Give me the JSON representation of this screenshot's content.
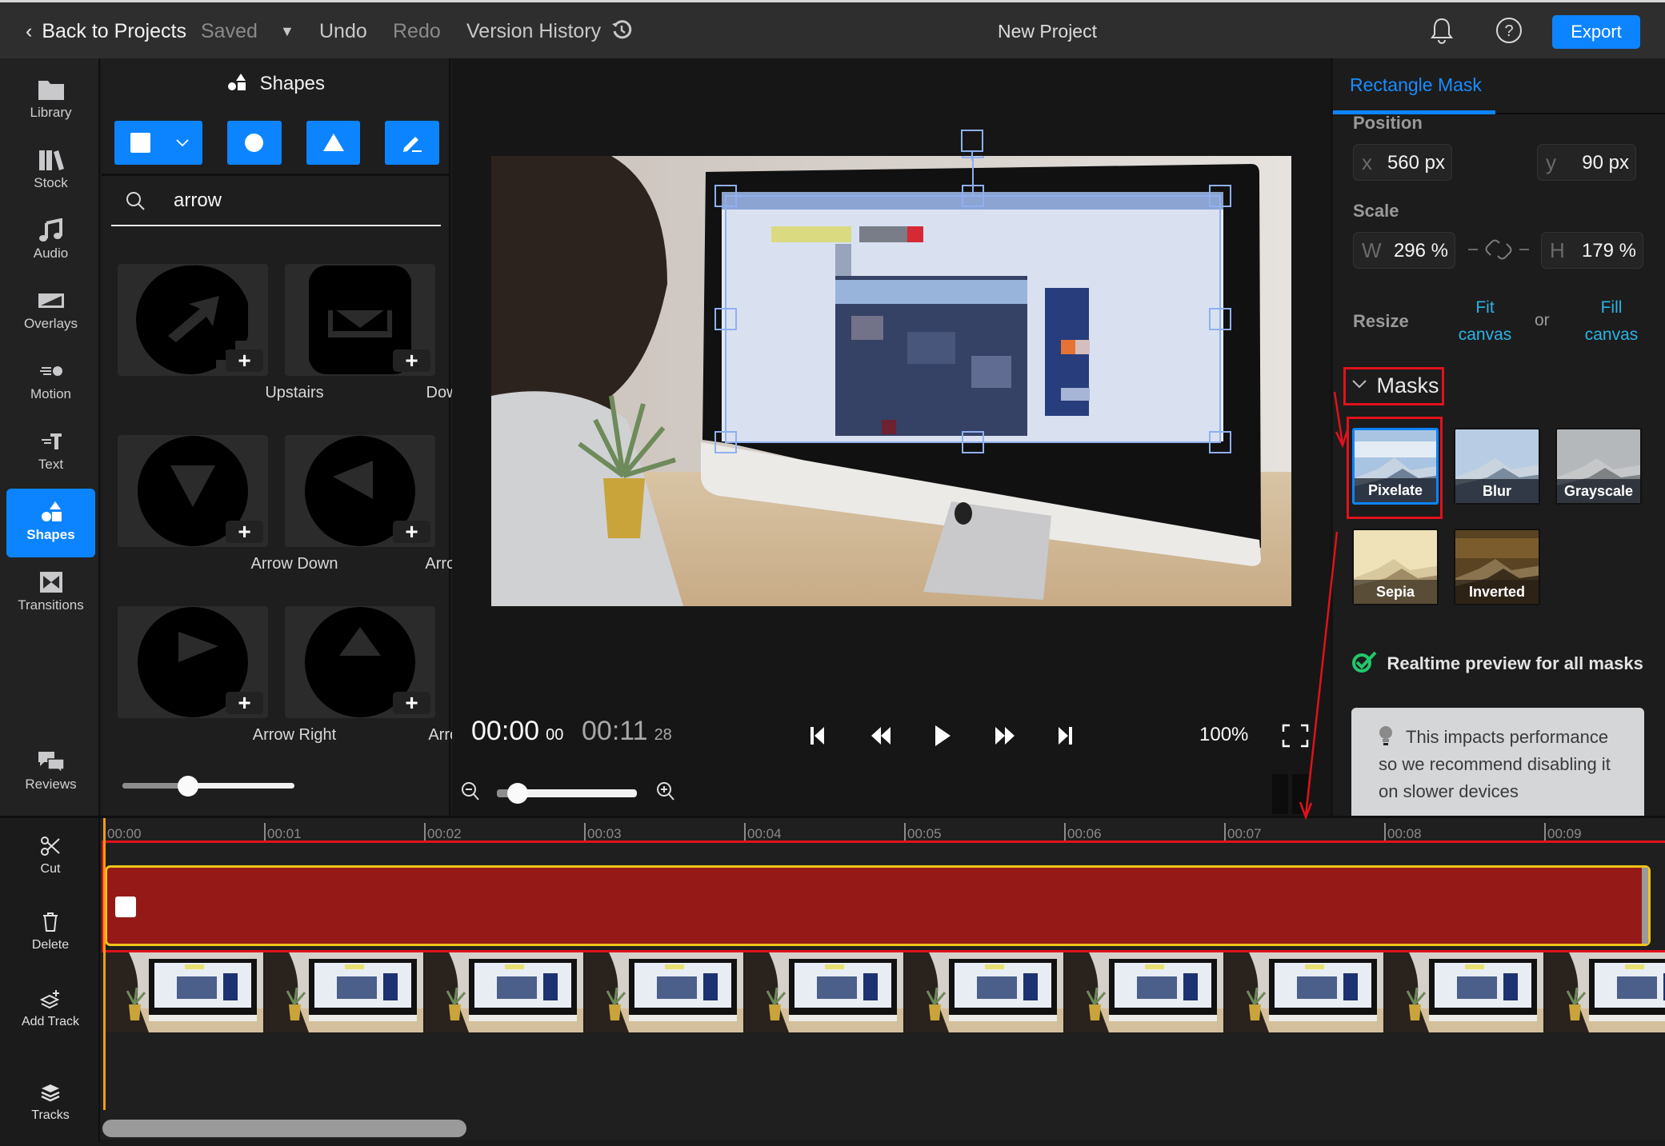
{
  "topbar": {
    "back_label": "Back to Projects",
    "saved_label": "Saved",
    "undo_label": "Undo",
    "redo_label": "Redo",
    "version_history_label": "Version History",
    "project_title": "New Project",
    "export_label": "Export"
  },
  "left_nav": {
    "items": [
      {
        "label": "Library",
        "icon": "folder-icon"
      },
      {
        "label": "Stock",
        "icon": "stock-books-icon"
      },
      {
        "label": "Audio",
        "icon": "music-note-icon"
      },
      {
        "label": "Overlays",
        "icon": "overlay-icon"
      },
      {
        "label": "Motion",
        "icon": "motion-icon"
      },
      {
        "label": "Text",
        "icon": "text-icon"
      },
      {
        "label": "Shapes",
        "icon": "shapes-icon",
        "active": true
      },
      {
        "label": "Transitions",
        "icon": "transition-icon"
      },
      {
        "label": "Reviews",
        "icon": "chat-bubbles-icon"
      }
    ]
  },
  "shapes_panel": {
    "title": "Shapes",
    "tool_buttons": [
      "rectangle",
      "circle",
      "triangle",
      "pen"
    ],
    "search": {
      "value": "arrow",
      "placeholder": "Search"
    },
    "items": [
      {
        "label": "Upstairs"
      },
      {
        "label": "Download"
      },
      {
        "label": "Arrow Down"
      },
      {
        "label": "Arrow Left"
      },
      {
        "label": "Arrow Right"
      },
      {
        "label": "Arrow Up"
      }
    ],
    "size_slider_value": 0.38
  },
  "player": {
    "current_time": "00:00",
    "current_frames": "00",
    "duration": "00:11",
    "duration_frames": "28",
    "zoom": "100%",
    "timeline_zoom_slider_value": 0.15
  },
  "right_panel": {
    "tab": "Rectangle Mask",
    "position_label": "Position",
    "x_prefix": "x",
    "x_value": "560 px",
    "y_prefix": "y",
    "y_value": "90 px",
    "scale_label": "Scale",
    "w_prefix": "W",
    "w_value": "296 %",
    "h_prefix": "H",
    "h_value": "179 %",
    "resize_label": "Resize",
    "fit_canvas_line1": "Fit",
    "fit_canvas_line2": "canvas",
    "or_label": "or",
    "fill_canvas_line1": "Fill",
    "fill_canvas_line2": "canvas",
    "masks_label": "Masks",
    "masks": [
      {
        "label": "Pixelate",
        "selected": true
      },
      {
        "label": "Blur"
      },
      {
        "label": "Grayscale"
      },
      {
        "label": "Sepia"
      },
      {
        "label": "Inverted"
      }
    ],
    "realtime_label": "Realtime preview for all masks",
    "tip_text": "This impacts performance so we recommend disabling it on slower devices"
  },
  "timeline": {
    "tools": [
      {
        "label": "Cut",
        "icon": "scissors-icon"
      },
      {
        "label": "Delete",
        "icon": "trash-icon"
      },
      {
        "label": "Add Track",
        "icon": "add-layer-icon"
      },
      {
        "label": "Tracks",
        "icon": "layers-icon"
      }
    ],
    "ticks": [
      "00:00",
      "00:01",
      "00:02",
      "00:03",
      "00:04",
      "00:05",
      "00:06",
      "00:07",
      "00:08",
      "00:09"
    ]
  },
  "colors": {
    "accent": "#0d84ff",
    "mask_track": "#951916",
    "track_border": "#f0c419",
    "annotation_red": "#e0121b",
    "link_cyan": "#2bb3e5",
    "check_green": "#22c76a"
  }
}
